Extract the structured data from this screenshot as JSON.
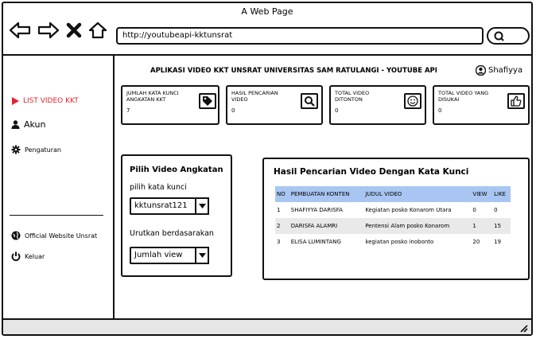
{
  "browser": {
    "window_title": "A Web Page",
    "url": "http://youtubeapi-kktunsrat"
  },
  "sidebar": {
    "items": [
      {
        "label": "LIST VIDEO KKT",
        "icon": "play-icon",
        "active": true
      },
      {
        "label": "Akun",
        "icon": "user-icon"
      },
      {
        "label": "Pengaturan",
        "icon": "gear-icon"
      }
    ],
    "bottom_items": [
      {
        "label": "Official Website Unsrat",
        "icon": "globe-icon"
      },
      {
        "label": "Keluar",
        "icon": "power-icon"
      }
    ]
  },
  "header": {
    "title": "APLIKASI VIDEO KKT UNSRAT UNIVERSITAS SAM RATULANGI - YOUTUBE API",
    "user_name": "Shafiyya"
  },
  "stats": [
    {
      "label": "JUMLAH KATA KUNCI ANGKATAN KKT",
      "value": "7",
      "icon": "tag-icon"
    },
    {
      "label": "HASIL PENCARIAN VIDEO",
      "value": "0",
      "icon": "search-icon"
    },
    {
      "label": "TOTAL VIDEO DITONTON",
      "value": "0",
      "icon": "smiley-icon"
    },
    {
      "label": "TOTAL VIDEO YANG DISUKAI",
      "value": "0",
      "icon": "thumbs-up-icon"
    }
  ],
  "filter": {
    "title": "Pilih Video Angkatan",
    "keyword_label": "pilih kata kunci",
    "keyword_value": "kktunsrat121",
    "sort_label": "Urutkan berdasarakan",
    "sort_value": "Jumlah view"
  },
  "results": {
    "title": "Hasil Pencarian Video Dengan Kata Kunci",
    "columns": [
      "NO",
      "PEMBUATAN KONTEN",
      "JUDUL VIDEO",
      "VIEW",
      "LIKE"
    ],
    "rows": [
      [
        "1",
        "SHAFIYYA DARISFA",
        "Kegiatan posko Konarom Utara",
        "0",
        "0"
      ],
      [
        "2",
        "DARISFA ALAMRI",
        "Pentensi Alam posko Konarom",
        "1",
        "15"
      ],
      [
        "3",
        "ELISA LUMINTANG",
        "kegiatan posko inobonto",
        "20",
        "19"
      ]
    ]
  }
}
